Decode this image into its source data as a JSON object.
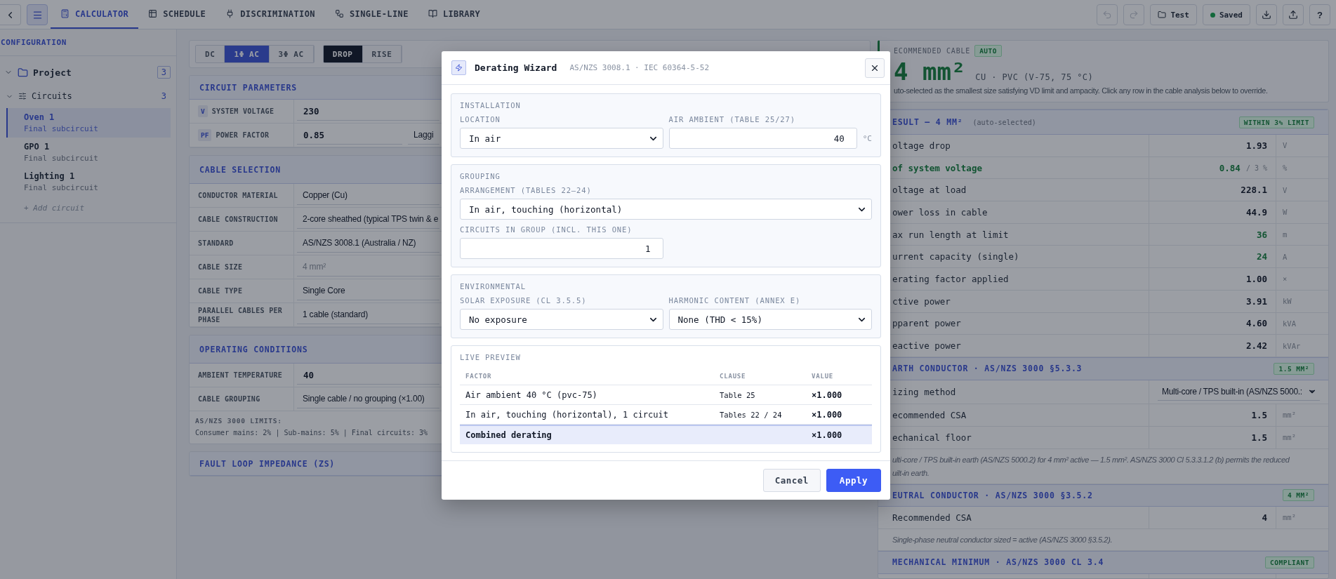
{
  "toolbar": {
    "tabs": [
      {
        "label": "CALCULATOR",
        "selected": true
      },
      {
        "label": "SCHEDULE",
        "selected": false
      },
      {
        "label": "DISCRIMINATION",
        "selected": false
      },
      {
        "label": "SINGLE-LINE",
        "selected": false
      },
      {
        "label": "LIBRARY",
        "selected": false
      }
    ],
    "undo_disabled": true,
    "redo_disabled": true,
    "project_button": "Test",
    "save_status": "Saved",
    "help": "?"
  },
  "sidebar": {
    "title": "CONFIGURATION",
    "project": {
      "label": "Project",
      "count": "3",
      "expanded": true
    },
    "group": {
      "label": "Circuits",
      "count": "3",
      "expanded": true
    },
    "circuits": [
      {
        "name": "Oven 1",
        "subtitle": "Final subcircuit",
        "selected": true
      },
      {
        "name": "GPO 1",
        "subtitle": "Final subcircuit",
        "selected": false
      },
      {
        "name": "Lighting 1",
        "subtitle": "Final subcircuit",
        "selected": false
      }
    ],
    "add_link": "+ Add circuit"
  },
  "mode_bar": {
    "system": [
      {
        "label": "DC",
        "selected": false
      },
      {
        "label": "1Φ AC",
        "selected": true
      },
      {
        "label": "3Φ AC",
        "selected": false
      }
    ],
    "calc": [
      {
        "label": "DROP",
        "selected": true
      },
      {
        "label": "RISE",
        "selected": false
      }
    ]
  },
  "sections": [
    {
      "title": "CIRCUIT PARAMETERS",
      "rows": [
        {
          "badge": "V",
          "label": "SYSTEM VOLTAGE",
          "fields": [
            {
              "kind": "input",
              "value": "230",
              "disabled": false
            }
          ]
        },
        {
          "badge": "PF",
          "label": "POWER FACTOR",
          "fields": [
            {
              "kind": "input",
              "value": "0.85",
              "disabled": false
            },
            {
              "kind": "select",
              "value": "Laggi",
              "disabled": false
            }
          ]
        }
      ]
    },
    {
      "title": "CABLE SELECTION",
      "rows": [
        {
          "label": "CONDUCTOR MATERIAL",
          "fields": [
            {
              "kind": "select",
              "value": "Copper (Cu)",
              "disabled": false
            }
          ]
        },
        {
          "label": "CABLE CONSTRUCTION",
          "fields": [
            {
              "kind": "select",
              "value": "2-core sheathed (typical TPS twin & e",
              "disabled": false
            }
          ]
        },
        {
          "label": "STANDARD",
          "fields": [
            {
              "kind": "select",
              "value": "AS/NZS 3008.1 (Australia / NZ)",
              "disabled": false
            }
          ]
        },
        {
          "label": "CABLE SIZE",
          "fields": [
            {
              "kind": "select",
              "value": "4 mm²",
              "disabled": true
            }
          ]
        },
        {
          "label": "CABLE TYPE",
          "fields": [
            {
              "kind": "select",
              "value": "Single Core",
              "disabled": false
            }
          ]
        },
        {
          "label": "PARALLEL CABLES PER PHASE",
          "fields": [
            {
              "kind": "select",
              "value": "1 cable (standard)",
              "disabled": false
            }
          ]
        }
      ]
    },
    {
      "title": "OPERATING CONDITIONS",
      "rows": [
        {
          "label": "AMBIENT TEMPERATURE",
          "fields": [
            {
              "kind": "input",
              "value": "40",
              "disabled": false
            }
          ]
        },
        {
          "label": "CABLE GROUPING",
          "fields": [
            {
              "kind": "select",
              "value": "Single cable / no grouping (×1.00)",
              "disabled": false
            }
          ]
        }
      ],
      "footer": {
        "title": "AS/NZS 3000 LIMITS:",
        "text": "Consumer mains: 2% | Sub-mains: 5% | Final circuits: 3%"
      }
    },
    {
      "title": "FAULT LOOP IMPEDANCE (ZS)"
    }
  ],
  "recommended": {
    "label": "ECOMMENDED CABLE",
    "badge": "AUTO",
    "size": "4 mm²",
    "spec": "CU · PVC (V-75, 75 °C)",
    "note": "uto-selected as the smallest size satisfying VD limit and ampacity. Click any row in the cable analysis below to override."
  },
  "result": {
    "title": "ESULT — 4 MM²",
    "subtitle": "(auto-selected)",
    "badge": "WITHIN 3% LIMIT",
    "rows": [
      {
        "label": "oltage drop",
        "value": "1.93",
        "unit": "V",
        "good": false,
        "label_good": false
      },
      {
        "label": "of system voltage",
        "value": "0.84",
        "limit": "/ 3 %",
        "unit": "%",
        "good": true,
        "label_good": true
      },
      {
        "label": "oltage at load",
        "value": "228.1",
        "unit": "V",
        "good": false,
        "label_good": false
      },
      {
        "label": "ower loss in cable",
        "value": "44.9",
        "unit": "W",
        "good": false,
        "label_good": false
      },
      {
        "label": "ax run length at limit",
        "value": "36",
        "unit": "m",
        "good": true,
        "label_good": false
      },
      {
        "label": "urrent capacity (single)",
        "value": "24",
        "unit": "A",
        "good": true,
        "label_good": false
      },
      {
        "label": "erating factor applied",
        "value": "1.00",
        "unit": "×",
        "good": false,
        "label_good": false
      },
      {
        "label": "ctive power",
        "value": "3.91",
        "unit": "kW",
        "good": false,
        "label_good": false
      },
      {
        "label": "pparent power",
        "value": "4.60",
        "unit": "kVA",
        "good": false,
        "label_good": false
      },
      {
        "label": "eactive power",
        "value": "2.42",
        "unit": "kVAr",
        "good": false,
        "label_good": false
      }
    ]
  },
  "earth": {
    "title": "ARTH CONDUCTOR · AS/NZS 3000 §5.3.3",
    "badge": "1.5 MM²",
    "method": {
      "label": "izing method",
      "value": "Multi-core / TPS built-in (AS/NZS 5000.:"
    },
    "rows": [
      {
        "label": "ecommended CSA",
        "value": "1.5",
        "unit": "mm²"
      },
      {
        "label": "echanical floor",
        "value": "1.5",
        "unit": "mm²"
      }
    ],
    "note_lines": [
      "ulti-core / TPS built-in earth (AS/NZS 5000.2) for 4 mm² active — 1.5 mm². AS/NZS 3000 Cl 5.3.3.1.2 (b) permits the reduced",
      "uilt-in earth."
    ]
  },
  "neutral": {
    "title": "EUTRAL CONDUCTOR · AS/NZS 3000 §3.5.2",
    "badge": "4 MM²",
    "rows": [
      {
        "label": "Recommended CSA",
        "value": "4",
        "unit": "mm²"
      }
    ],
    "note": "Single-phase neutral conductor sized = active (AS/NZS 3000 §3.5.2)."
  },
  "mechanical": {
    "title": "MECHANICAL MINIMUM · AS/NZS 3000 CL 3.4",
    "badge": "COMPLIANT"
  },
  "dialog": {
    "title": "Derating Wizard",
    "subtitle": "AS/NZS 3008.1 · IEC 60364-5-52",
    "groups": [
      {
        "title": "INSTALLATION",
        "rows": [
          [
            {
              "kind": "select",
              "label": "LOCATION",
              "value": "In air"
            },
            {
              "kind": "number",
              "label": "AIR AMBIENT (TABLE 25/27)",
              "value": "40",
              "unit": "°C"
            }
          ]
        ]
      },
      {
        "title": "GROUPING",
        "rows": [
          [
            {
              "kind": "select",
              "label": "ARRANGEMENT (TABLES 22–24)",
              "value": "In air, touching (horizontal)"
            }
          ],
          [
            {
              "kind": "number",
              "label": "CIRCUITS IN GROUP (INCL. THIS ONE)",
              "value": "1"
            }
          ]
        ]
      },
      {
        "title": "ENVIRONMENTAL",
        "rows": [
          [
            {
              "kind": "select",
              "label": "SOLAR EXPOSURE (CL 3.5.5)",
              "value": "No exposure"
            },
            {
              "kind": "select",
              "label": "HARMONIC CONTENT (ANNEX E)",
              "value": "None (THD < 15%)"
            }
          ]
        ]
      }
    ],
    "preview": {
      "title": "LIVE PREVIEW",
      "columns": [
        "FACTOR",
        "CLAUSE",
        "VALUE"
      ],
      "rows": [
        {
          "factor": "Air ambient 40 °C (pvc-75)",
          "clause": "Table 25",
          "value": "×1.000"
        },
        {
          "factor": "In air, touching (horizontal), 1 circuit",
          "clause": "Tables 22 / 24",
          "value": "×1.000"
        }
      ],
      "total": {
        "label": "Combined derating",
        "value": "×1.000"
      }
    },
    "buttons": [
      {
        "label": "Cancel",
        "kind": "secondary"
      },
      {
        "label": "Apply",
        "kind": "primary"
      }
    ]
  }
}
